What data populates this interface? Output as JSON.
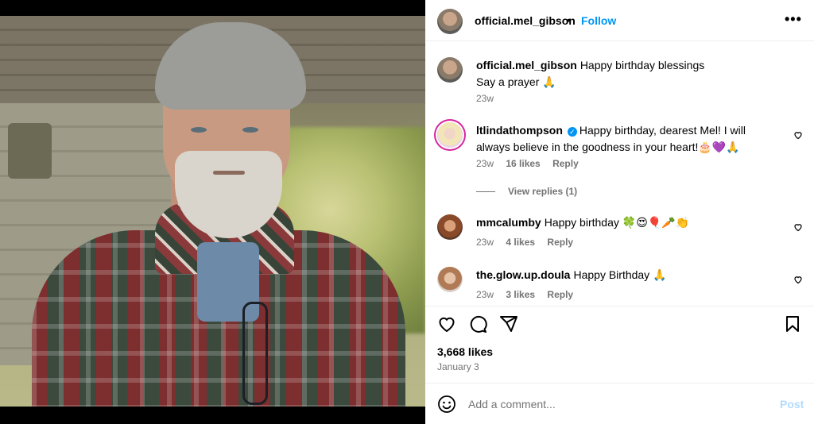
{
  "post": {
    "username": "official.mel_gibson",
    "dot": "•",
    "follow_label": "Follow",
    "more_label": "•••"
  },
  "caption": {
    "username": "official.mel_gibson",
    "text_line1": "Happy birthday blessings",
    "text_line2": "Say a prayer 🙏",
    "age": "23w"
  },
  "comments": [
    {
      "username": "ltlindathompson",
      "verified": true,
      "text": "Happy birthday, dearest Mel! I will always believe in the goodness in your heart!🎂💜🙏",
      "age": "23w",
      "likes": "16 likes",
      "reply": "Reply",
      "view_replies": "View replies (1)"
    },
    {
      "username": "mmcalumby",
      "text": "Happy birthday 🍀😍🎈🥕👏",
      "age": "23w",
      "likes": "4 likes",
      "reply": "Reply"
    },
    {
      "username": "the.glow.up.doula",
      "text": "Happy Birthday 🙏",
      "age": "23w",
      "likes": "3 likes",
      "reply": "Reply"
    }
  ],
  "stats": {
    "likes": "3,668 likes",
    "date": "January 3"
  },
  "add_comment": {
    "placeholder": "Add a comment...",
    "post_label": "Post"
  },
  "icons": [
    "heart-icon",
    "comment-icon",
    "share-icon",
    "bookmark-icon",
    "emoji-icon",
    "more-icon",
    "verified-icon"
  ],
  "colors": {
    "accent": "#0095f6",
    "muted": "#737373",
    "post_disabled": "#b3dbff"
  }
}
